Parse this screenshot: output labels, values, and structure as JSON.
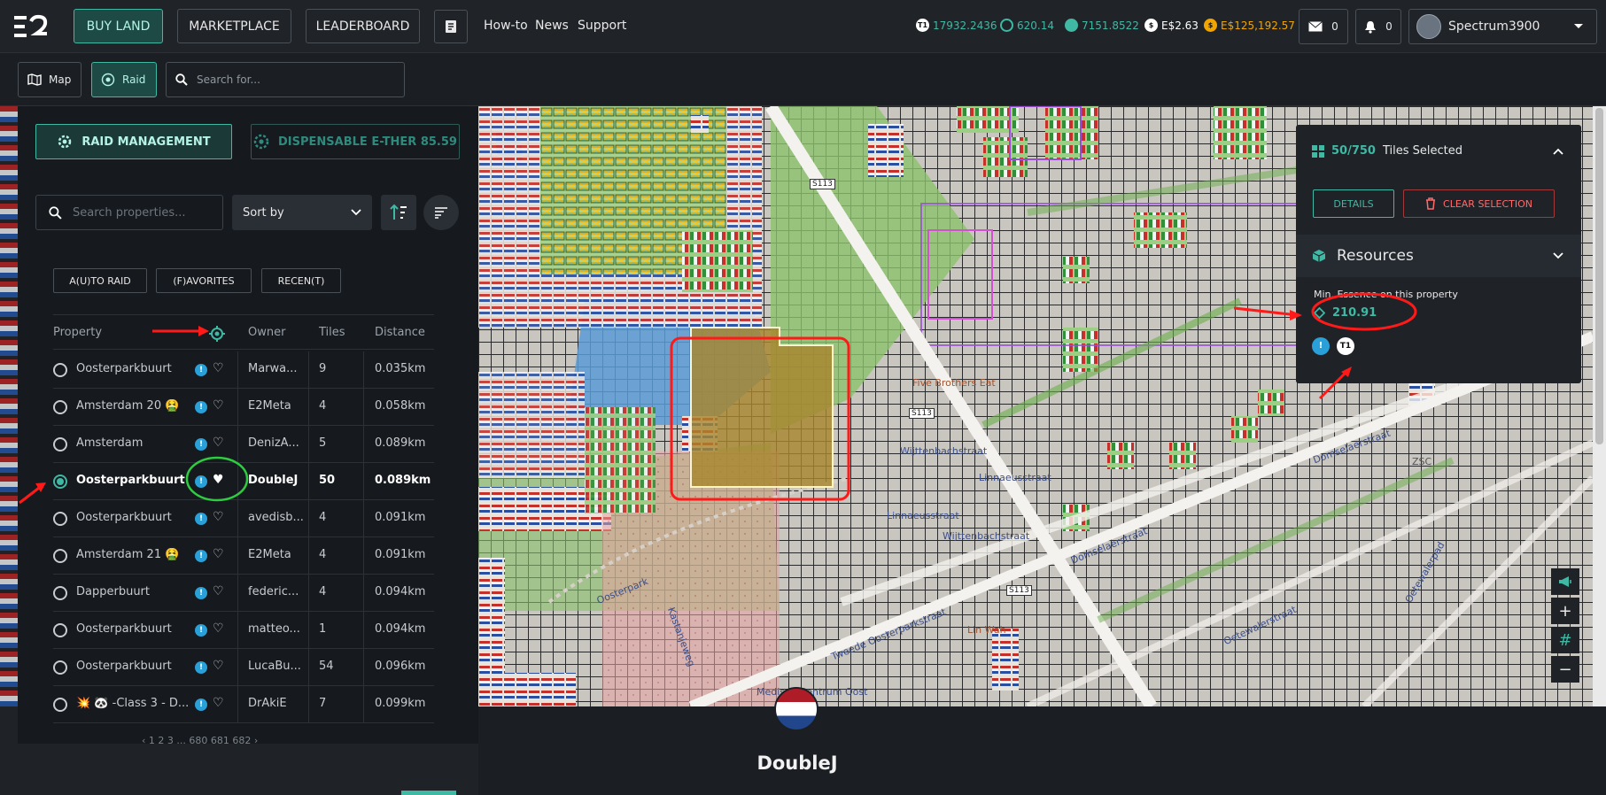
{
  "nav": {
    "buy_land": "BUY LAND",
    "marketplace": "MARKETPLACE",
    "leaderboard": "LEADERBOARD",
    "howto": "How-to",
    "news": "News",
    "support": "Support"
  },
  "wallet": {
    "t1": "17932.2436",
    "essence": "620.14",
    "ether": "7151.8522",
    "e_dollar": "E$2.63",
    "gold": "E$125,192.57"
  },
  "counters": {
    "mail": "0",
    "notifications": "0"
  },
  "user": {
    "name": "Spectrum3900"
  },
  "subbar": {
    "map": "Map",
    "raid": "Raid",
    "search_placeholder": "Search for..."
  },
  "raid": {
    "management": "RAID MANAGEMENT",
    "dispensable": "DISPENSABLE E-THER 85.59",
    "search_placeholder": "Search properties...",
    "sort_by": "Sort by",
    "filters": [
      "A(U)TO RAID",
      "(F)AVORITES",
      "RECEN(T)"
    ]
  },
  "table": {
    "headers": {
      "property": "Property",
      "owner": "Owner",
      "tiles": "Tiles",
      "distance": "Distance"
    },
    "rows": [
      {
        "property": "Oosterparkbuurt",
        "owner": "Marwa...",
        "tiles": "9",
        "distance": "0.035km"
      },
      {
        "property": "Amsterdam 20 🤮",
        "owner": "E2Meta",
        "tiles": "4",
        "distance": "0.058km"
      },
      {
        "property": "Amsterdam",
        "owner": "DenizA...",
        "tiles": "5",
        "distance": "0.089km"
      },
      {
        "property": "Oosterparkbuurt",
        "owner": "DoubleJ",
        "tiles": "50",
        "distance": "0.089km"
      },
      {
        "property": "Oosterparkbuurt",
        "owner": "avedisb...",
        "tiles": "4",
        "distance": "0.091km"
      },
      {
        "property": "Amsterdam 21 🤮",
        "owner": "E2Meta",
        "tiles": "4",
        "distance": "0.091km"
      },
      {
        "property": "Dapperbuurt",
        "owner": "federic...",
        "tiles": "4",
        "distance": "0.094km"
      },
      {
        "property": "Oosterparkbuurt",
        "owner": "matteo...",
        "tiles": "1",
        "distance": "0.094km"
      },
      {
        "property": "Oosterparkbuurt",
        "owner": "LucaBu...",
        "tiles": "54",
        "distance": "0.096km"
      },
      {
        "property": "💥 🐼 -Class 3 - D...",
        "owner": "DrAkiE",
        "tiles": "7",
        "distance": "0.099km"
      }
    ],
    "pager": "‹  1  2  3  ...  680  681  682  ›"
  },
  "tile_panel": {
    "selected": "50/750",
    "selected_suffix": "Tiles Selected",
    "details": "DETAILS",
    "clear": "CLEAR SELECTION",
    "resources": "Resources",
    "essence_label": "Min. Essence on this property",
    "essence_value": "210.91"
  },
  "map_labels": {
    "s113": "S113",
    "five_brothers": "Five Brothers Eat",
    "wijttenbach1": "Wijttenbachstraat",
    "wijttenbach2": "Wijttenbachstraat",
    "linnaeus1": "Linnaeusstraat",
    "linnaeus2": "Linnaeusstraat",
    "domselaer1": "Domselaerstraat",
    "domselaer2": "Domselaerstraat",
    "oosterpark": "Oosterpark",
    "kastanjeweg": "Kastanjeweg",
    "tweede": "Tweede Oosterparkstraat",
    "linwah": "Lin Wah",
    "medisch": "Medisch Centrum Oost",
    "oetewaler1": "Oetewalerstraat",
    "oetewaler2": "Oetewalerpad",
    "zsc": "ZSC"
  },
  "owner": {
    "name": "DoubleJ"
  },
  "colors": {
    "accent": "#3fb8a4",
    "annotation_red": "#ff1a1a",
    "annotation_green": "#2ecc40"
  }
}
